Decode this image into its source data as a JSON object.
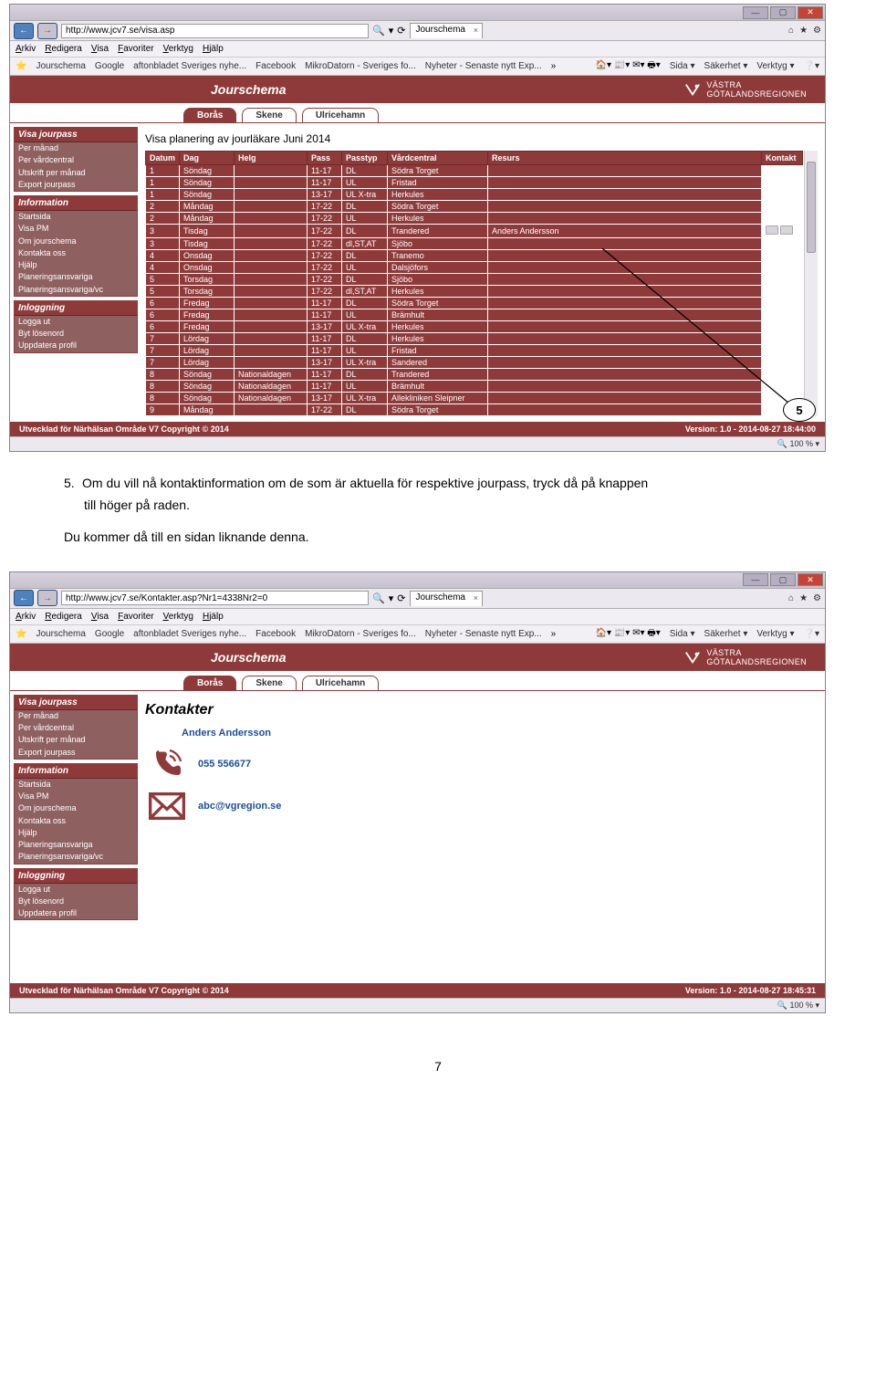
{
  "browser": {
    "url1": "http://www.jcv7.se/visa.asp",
    "url2": "http://www.jcv7.se/Kontakter.asp?Nr1=4338Nr2=0",
    "search_glyph": "🔍",
    "refresh_glyph": "⟳",
    "tab_title": "Jourschema",
    "tab_x": "×",
    "home_icon": "⌂",
    "star_icon": "★",
    "gear_icon": "⚙",
    "min": "—",
    "max": "▢",
    "close": "✕"
  },
  "menus": [
    "Arkiv",
    "Redigera",
    "Visa",
    "Favoriter",
    "Verktyg",
    "Hjälp"
  ],
  "favs": [
    "Jourschema",
    "Google",
    "aftonbladet Sveriges nyhe...",
    "Facebook",
    "MikroDatorn - Sveriges fo...",
    "Nyheter - Senaste nytt Exp..."
  ],
  "fav_right": [
    "Sida ▾",
    "Säkerhet ▾",
    "Verktyg ▾",
    "❔▾"
  ],
  "app": {
    "title": "Jourschema",
    "brand1": "VÄSTRA",
    "brand2": "GÖTALANDSREGIONEN"
  },
  "tabs": [
    "Borås",
    "Skene",
    "Ulricehamn"
  ],
  "sidebar": {
    "g1": {
      "h": "Visa jourpass",
      "items": [
        "Per månad",
        "Per vårdcentral",
        "Utskrift per månad",
        "Export jourpass"
      ]
    },
    "g2": {
      "h": "Information",
      "items": [
        "Startsida",
        "Visa PM",
        "Om jourschema",
        "Kontakta oss",
        "Hjälp",
        "Planeringsansvariga",
        "Planeringsansvariga/vc"
      ]
    },
    "g3": {
      "h": "Inloggning",
      "items": [
        "Logga ut",
        "Byt lösenord",
        "Uppdatera profil"
      ]
    }
  },
  "plan_title": "Visa planering av jourläkare   Juni   2014",
  "thead": [
    "Datum",
    "Dag",
    "Helg",
    "Pass",
    "Passtyp",
    "Vårdcentral",
    "Resurs",
    "Kontakt"
  ],
  "rows": [
    {
      "d": "1",
      "dag": "Söndag",
      "helg": "",
      "pass": "11-17",
      "typ": "DL",
      "vc": "Södra Torget",
      "res": "",
      "k": ""
    },
    {
      "d": "1",
      "dag": "Söndag",
      "helg": "",
      "pass": "11-17",
      "typ": "UL",
      "vc": "Fristad",
      "res": "",
      "k": ""
    },
    {
      "d": "1",
      "dag": "Söndag",
      "helg": "",
      "pass": "13-17",
      "typ": "UL X-tra",
      "vc": "Herkules",
      "res": "",
      "k": ""
    },
    {
      "d": "2",
      "dag": "Måndag",
      "helg": "",
      "pass": "17-22",
      "typ": "DL",
      "vc": "Södra Torget",
      "res": "",
      "k": ""
    },
    {
      "d": "2",
      "dag": "Måndag",
      "helg": "",
      "pass": "17-22",
      "typ": "UL",
      "vc": "Herkules",
      "res": "",
      "k": ""
    },
    {
      "d": "3",
      "dag": "Tisdag",
      "helg": "",
      "pass": "17-22",
      "typ": "DL",
      "vc": "Trandered",
      "res": "Anders Andersson",
      "k": "icons"
    },
    {
      "d": "3",
      "dag": "Tisdag",
      "helg": "",
      "pass": "17-22",
      "typ": "dl,ST,AT",
      "vc": "Sjöbo",
      "res": "",
      "k": ""
    },
    {
      "d": "4",
      "dag": "Onsdag",
      "helg": "",
      "pass": "17-22",
      "typ": "DL",
      "vc": "Tranemo",
      "res": "",
      "k": ""
    },
    {
      "d": "4",
      "dag": "Onsdag",
      "helg": "",
      "pass": "17-22",
      "typ": "UL",
      "vc": "Dalsjöfors",
      "res": "",
      "k": ""
    },
    {
      "d": "5",
      "dag": "Torsdag",
      "helg": "",
      "pass": "17-22",
      "typ": "DL",
      "vc": "Sjöbo",
      "res": "",
      "k": ""
    },
    {
      "d": "5",
      "dag": "Torsdag",
      "helg": "",
      "pass": "17-22",
      "typ": "dl,ST,AT",
      "vc": "Herkules",
      "res": "",
      "k": ""
    },
    {
      "d": "6",
      "dag": "Fredag",
      "helg": "",
      "pass": "11-17",
      "typ": "DL",
      "vc": "Södra Torget",
      "res": "",
      "k": ""
    },
    {
      "d": "6",
      "dag": "Fredag",
      "helg": "",
      "pass": "11-17",
      "typ": "UL",
      "vc": "Brämhult",
      "res": "",
      "k": ""
    },
    {
      "d": "6",
      "dag": "Fredag",
      "helg": "",
      "pass": "13-17",
      "typ": "UL X-tra",
      "vc": "Herkules",
      "res": "",
      "k": ""
    },
    {
      "d": "7",
      "dag": "Lördag",
      "helg": "",
      "pass": "11-17",
      "typ": "DL",
      "vc": "Herkules",
      "res": "",
      "k": ""
    },
    {
      "d": "7",
      "dag": "Lördag",
      "helg": "",
      "pass": "11-17",
      "typ": "UL",
      "vc": "Fristad",
      "res": "",
      "k": ""
    },
    {
      "d": "7",
      "dag": "Lördag",
      "helg": "",
      "pass": "13-17",
      "typ": "UL X-tra",
      "vc": "Sandered",
      "res": "",
      "k": ""
    },
    {
      "d": "8",
      "dag": "Söndag",
      "helg": "Nationaldagen",
      "pass": "11-17",
      "typ": "DL",
      "vc": "Trandered",
      "res": "",
      "k": ""
    },
    {
      "d": "8",
      "dag": "Söndag",
      "helg": "Nationaldagen",
      "pass": "11-17",
      "typ": "UL",
      "vc": "Brämhult",
      "res": "",
      "k": ""
    },
    {
      "d": "8",
      "dag": "Söndag",
      "helg": "Nationaldagen",
      "pass": "13-17",
      "typ": "UL X-tra",
      "vc": "Allekliniken Sleipner",
      "res": "",
      "k": ""
    },
    {
      "d": "9",
      "dag": "Måndag",
      "helg": "",
      "pass": "17-22",
      "typ": "DL",
      "vc": "Södra Torget",
      "res": "",
      "k": ""
    }
  ],
  "footer": {
    "left": "Utvecklad för Närhälsan Område V7 Copyright © 2014",
    "right1": "Version: 1.0 - 2014-08-27 18:44:00",
    "right2": "Version: 1.0 - 2014-08-27 18:45:31"
  },
  "zoom": "🔍 100 %  ▾",
  "callout": "5",
  "doc": {
    "num5": "5.",
    "t1a": "Om du vill nå kontaktinformation om de som är aktuella för respektive jourpass, tryck då på knappen",
    "t1b": "till höger på raden.",
    "t2": "Du kommer då till en sidan liknande denna."
  },
  "kontakt": {
    "title": "Kontakter",
    "name": "Anders Andersson",
    "phone": "055 556677",
    "email": "abc@vgregion.se"
  },
  "page_num": "7"
}
